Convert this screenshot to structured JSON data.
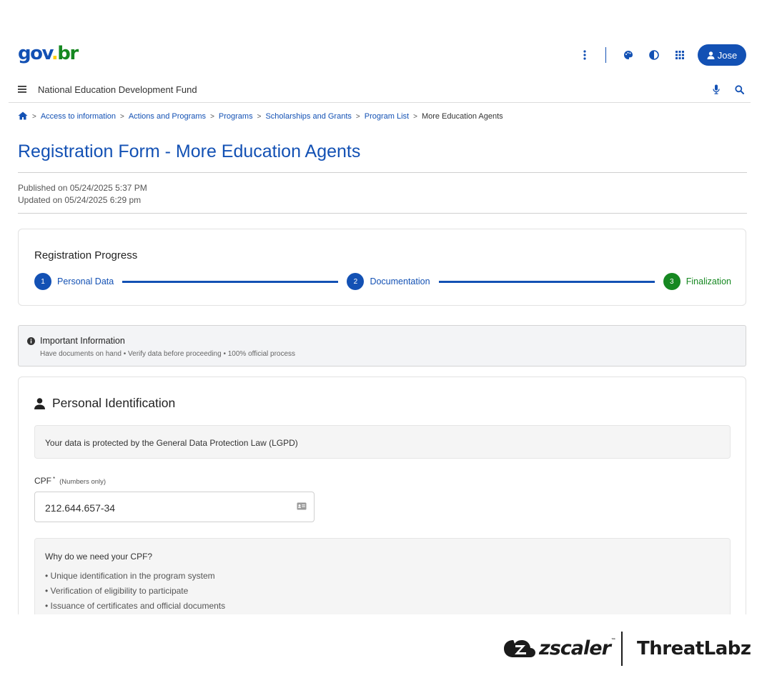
{
  "header": {
    "logo": {
      "part1": "gov",
      "dot": ".",
      "part2": "br"
    },
    "user_label": "Jose",
    "icons": [
      "more-vertical-icon",
      "palette-icon",
      "contrast-icon",
      "apps-grid-icon",
      "user-icon"
    ],
    "site_name": "National Education Development Fund"
  },
  "breadcrumb": {
    "items": [
      "Access to information",
      "Actions and Programs",
      "Programs",
      "Scholarships and Grants",
      "Program List"
    ],
    "current": "More Education Agents"
  },
  "page": {
    "title": "Registration Form - More Education Agents",
    "published": "Published on 05/24/2025 5:37 PM",
    "updated": "Updated on 05/24/2025 6:29 pm"
  },
  "progress": {
    "title": "Registration Progress",
    "steps": [
      {
        "num": "1",
        "label": "Personal Data"
      },
      {
        "num": "2",
        "label": "Documentation"
      },
      {
        "num": "3",
        "label": "Finalization"
      }
    ]
  },
  "info": {
    "title": "Important Information",
    "text": "Have documents on hand • Verify data before proceeding • 100% official process"
  },
  "personal_id": {
    "title": "Personal Identification",
    "lgpd": "Your data is protected by the General Data Protection Law (LGPD)",
    "cpf_label": "CPF",
    "cpf_required": "*",
    "cpf_hint": "(Numbers only)",
    "cpf_value": "212.644.657-34",
    "why_title": "Why do we need your CPF?",
    "why_items": [
      "Unique identification in the program system",
      "Verification of eligibility to participate",
      "Issuance of certificates and official documents"
    ]
  },
  "footer": {
    "brand1": "zscaler",
    "brand1_tm": "™",
    "brand2": "ThreatLabz"
  },
  "colors": {
    "primary": "#1351b4",
    "success": "#168821",
    "logo_yellow": "#ffcd07"
  }
}
